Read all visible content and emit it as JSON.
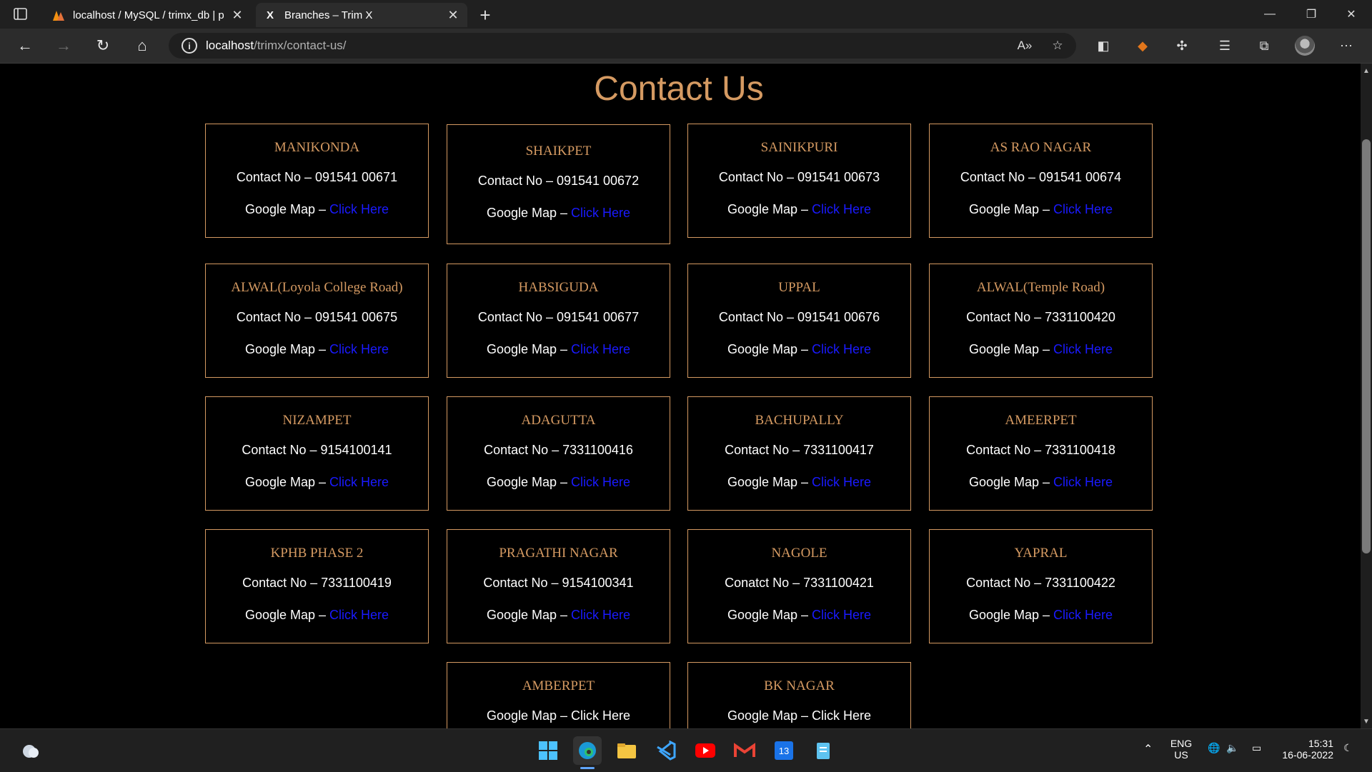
{
  "browser": {
    "tabs": [
      {
        "title": "localhost / MySQL / trimx_db | p",
        "favicon": "phpmyadmin-icon",
        "active": false
      },
      {
        "title": "Branches – Trim X",
        "favicon": "X",
        "active": true
      }
    ],
    "new_tab": "+",
    "url_host": "localhost",
    "url_path": "/trimx/contact-us/",
    "window_controls": {
      "minimize": "—",
      "restore": "❐",
      "close": "✕"
    }
  },
  "page": {
    "title": "Contact Us",
    "map_label": "Google Map – ",
    "map_link": "Click Here",
    "branches": [
      {
        "name": "MANIKONDA",
        "contact": "Contact No – 091541 00671"
      },
      {
        "name": "SHAIKPET",
        "contact": "Contact No – 091541 00672"
      },
      {
        "name": "SAINIKPURI",
        "contact": "Contact No – 091541 00673"
      },
      {
        "name": "AS RAO NAGAR",
        "contact": "Contact No –  091541 00674"
      },
      {
        "name": "ALWAL(Loyola College Road)",
        "contact": "Contact No – 091541 00675"
      },
      {
        "name": "HABSIGUDA",
        "contact": "Contact No – 091541 00677"
      },
      {
        "name": "UPPAL",
        "contact": "Contact No –  091541 00676"
      },
      {
        "name": "ALWAL(Temple Road)",
        "contact": "Contact No – 7331100420"
      },
      {
        "name": "NIZAMPET",
        "contact": "Contact No – 9154100141"
      },
      {
        "name": "ADAGUTTA",
        "contact": "Contact No – 7331100416"
      },
      {
        "name": "BACHUPALLY",
        "contact": "Contact No – 7331100417"
      },
      {
        "name": "AMEERPET",
        "contact": "Contact No – 7331100418"
      },
      {
        "name": "KPHB PHASE 2",
        "contact": "Contact No – 7331100419"
      },
      {
        "name": "PRAGATHI NAGAR",
        "contact": "Contact No – 9154100341"
      },
      {
        "name": "NAGOLE",
        "contact": "Conatct No – 7331100421"
      },
      {
        "name": "YAPRAL",
        "contact": "Contact No – 7331100422"
      },
      {
        "name": "AMBERPET",
        "contact": ""
      },
      {
        "name": "BK NAGAR",
        "contact": ""
      }
    ]
  },
  "taskbar": {
    "lang": "ENG",
    "region": "US",
    "time": "15:31",
    "date": "16-06-2022",
    "calendar_day": "13"
  },
  "colors": {
    "accent": "#d59a62",
    "link": "#1a1aff",
    "background": "#000000"
  }
}
